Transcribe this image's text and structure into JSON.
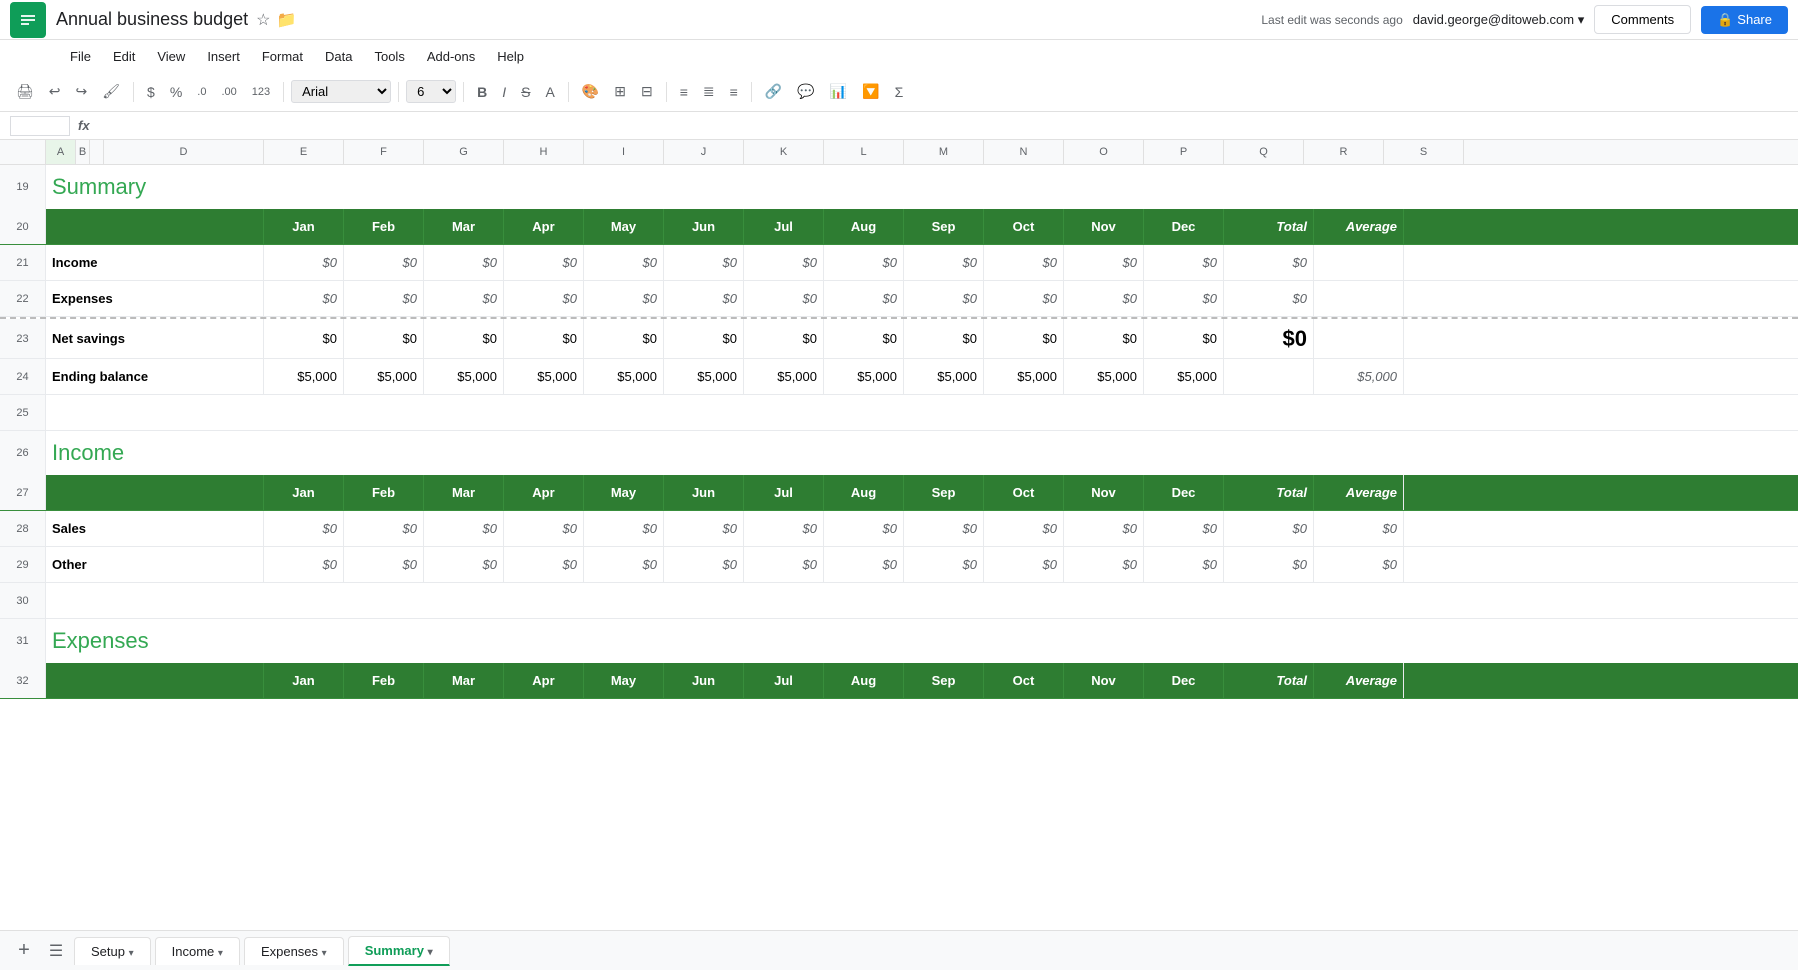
{
  "app": {
    "icon_color": "#0f9d58",
    "title": "Annual business budget",
    "last_edit": "Last edit was seconds ago",
    "user_email": "david.george@ditoweb.com ▾"
  },
  "menu": {
    "items": [
      "File",
      "Edit",
      "View",
      "Insert",
      "Format",
      "Data",
      "Tools",
      "Add-ons",
      "Help"
    ]
  },
  "toolbar": {
    "font": "Arial",
    "font_size": "6"
  },
  "formula_bar": {
    "cell_ref": "fx"
  },
  "columns": {
    "headers": [
      "",
      "Jan",
      "Feb",
      "Mar",
      "Apr",
      "May",
      "Jun",
      "Jul",
      "Aug",
      "Sep",
      "Oct",
      "Nov",
      "Dec",
      "Total",
      "Average"
    ]
  },
  "sections": {
    "summary": {
      "title": "Summary",
      "header_row": [
        "",
        "Jan",
        "Feb",
        "Mar",
        "Apr",
        "May",
        "Jun",
        "Jul",
        "Aug",
        "Sep",
        "Oct",
        "Nov",
        "Dec",
        "Total",
        "Average"
      ],
      "rows": [
        {
          "label": "Income",
          "values": [
            "$0",
            "$0",
            "$0",
            "$0",
            "$0",
            "$0",
            "$0",
            "$0",
            "$0",
            "$0",
            "$0",
            "$0"
          ],
          "total": "$0",
          "average": "",
          "italic": true
        },
        {
          "label": "Expenses",
          "values": [
            "$0",
            "$0",
            "$0",
            "$0",
            "$0",
            "$0",
            "$0",
            "$0",
            "$0",
            "$0",
            "$0",
            "$0"
          ],
          "total": "$0",
          "average": "",
          "italic": true
        },
        {
          "label": "Net savings",
          "values": [
            "$0",
            "$0",
            "$0",
            "$0",
            "$0",
            "$0",
            "$0",
            "$0",
            "$0",
            "$0",
            "$0",
            "$0"
          ],
          "total": "$0",
          "average": "",
          "total_big": true
        },
        {
          "label": "Ending balance",
          "values": [
            "$5,000",
            "$5,000",
            "$5,000",
            "$5,000",
            "$5,000",
            "$5,000",
            "$5,000",
            "$5,000",
            "$5,000",
            "$5,000",
            "$5,000",
            "$5,000"
          ],
          "total": "",
          "average": "$5,000",
          "italic": true
        }
      ]
    },
    "income": {
      "title": "Income",
      "header_row": [
        "",
        "Jan",
        "Feb",
        "Mar",
        "Apr",
        "May",
        "Jun",
        "Jul",
        "Aug",
        "Sep",
        "Oct",
        "Nov",
        "Dec",
        "Total",
        "Average"
      ],
      "rows": [
        {
          "label": "Sales",
          "values": [
            "$0",
            "$0",
            "$0",
            "$0",
            "$0",
            "$0",
            "$0",
            "$0",
            "$0",
            "$0",
            "$0",
            "$0"
          ],
          "total": "$0",
          "average": "$0",
          "italic": true
        },
        {
          "label": "Other",
          "values": [
            "$0",
            "$0",
            "$0",
            "$0",
            "$0",
            "$0",
            "$0",
            "$0",
            "$0",
            "$0",
            "$0",
            "$0"
          ],
          "total": "$0",
          "average": "$0",
          "italic": true
        }
      ]
    },
    "expenses": {
      "title": "Expenses",
      "header_row": [
        "",
        "Jan",
        "Feb",
        "Mar",
        "Apr",
        "May",
        "Jun",
        "Jul",
        "Aug",
        "Sep",
        "Oct",
        "Nov",
        "Dec",
        "Total",
        "Average"
      ]
    }
  },
  "row_numbers": {
    "visible_start": 19,
    "rows": [
      19,
      20,
      21,
      22,
      23,
      24,
      25,
      26,
      27,
      28,
      29,
      30,
      31,
      32
    ]
  },
  "tabs": {
    "sheets": [
      "Setup",
      "Income",
      "Expenses",
      "Summary"
    ],
    "active": "Summary"
  },
  "buttons": {
    "comments": "Comments",
    "share": "Share"
  }
}
